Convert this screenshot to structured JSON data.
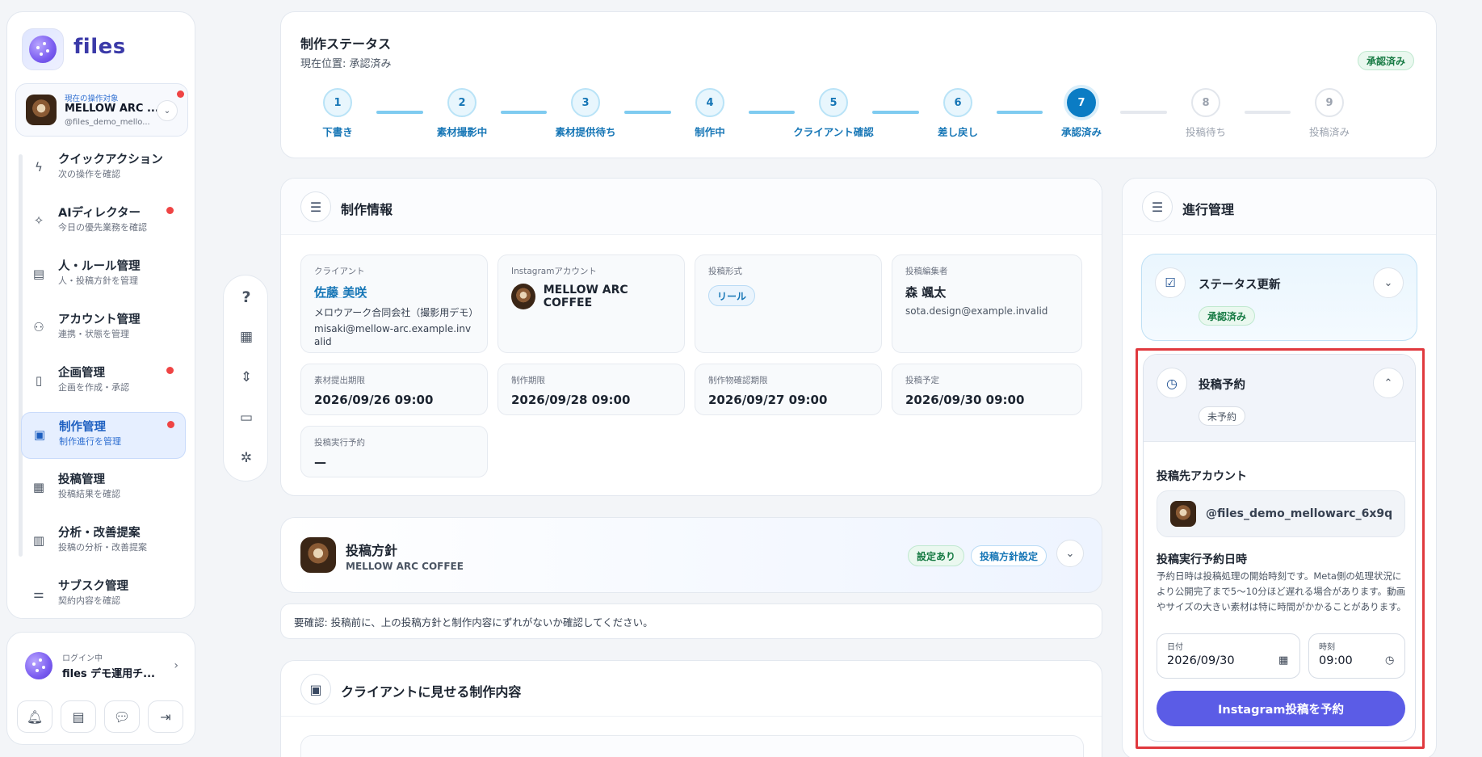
{
  "brand": {
    "name": "files"
  },
  "account_switcher": {
    "caption": "現在の操作対象",
    "name": "MELLOW ARC ...",
    "handle": "@files_demo_mello..."
  },
  "nav": {
    "items": [
      {
        "label": "クイックアクション",
        "sub": "次の操作を確認",
        "icon": "bolt-icon",
        "dot": false
      },
      {
        "label": "AIディレクター",
        "sub": "今日の優先業務を確認",
        "icon": "sparkle-icon",
        "dot": true
      },
      {
        "label": "人・ルール管理",
        "sub": "人・投稿方針を管理",
        "icon": "rules-icon",
        "dot": false
      },
      {
        "label": "アカウント管理",
        "sub": "連携・状態を管理",
        "icon": "users-icon",
        "dot": false
      },
      {
        "label": "企画管理",
        "sub": "企画を作成・承認",
        "icon": "document-icon",
        "dot": true
      },
      {
        "label": "制作管理",
        "sub": "制作進行を管理",
        "icon": "clipboard-icon",
        "dot": true,
        "active": true
      },
      {
        "label": "投稿管理",
        "sub": "投稿結果を確認",
        "icon": "calendar-icon",
        "dot": false
      },
      {
        "label": "分析・改善提案",
        "sub": "投稿の分析・改善提案",
        "icon": "chart-file-icon",
        "dot": false
      },
      {
        "label": "サブスク管理",
        "sub": "契約内容を確認",
        "icon": "sliders-icon",
        "dot": false
      }
    ]
  },
  "user": {
    "caption": "ログイン中",
    "name": "files デモ運用チ..."
  },
  "status": {
    "title": "制作ステータス",
    "current": "現在位置: 承認済み",
    "badge": "承認済み",
    "steps": [
      {
        "n": "1",
        "label": "下書き",
        "state": "done"
      },
      {
        "n": "2",
        "label": "素材撮影中",
        "state": "done"
      },
      {
        "n": "3",
        "label": "素材提供待ち",
        "state": "done"
      },
      {
        "n": "4",
        "label": "制作中",
        "state": "done"
      },
      {
        "n": "5",
        "label": "クライアント確認",
        "state": "done"
      },
      {
        "n": "6",
        "label": "差し戻し",
        "state": "done"
      },
      {
        "n": "7",
        "label": "承認済み",
        "state": "current"
      },
      {
        "n": "8",
        "label": "投稿待ち",
        "state": "future"
      },
      {
        "n": "9",
        "label": "投稿済み",
        "state": "future"
      }
    ]
  },
  "info": {
    "title": "制作情報",
    "client_label": "クライアント",
    "client_name": "佐藤 美咲",
    "client_company": "メロウアーク合同会社（撮影用デモ）",
    "client_email": "misaki@mellow-arc.example.invalid",
    "ig_label": "Instagramアカウント",
    "ig_value": "MELLOW ARC COFFEE",
    "format_label": "投稿形式",
    "format_value": "リール",
    "editor_label": "投稿編集者",
    "editor_name": "森 颯太",
    "editor_email": "sota.design@example.invalid",
    "material_deadline_label": "素材提出期限",
    "material_deadline": "2026/09/26 09:00",
    "production_deadline_label": "制作期限",
    "production_deadline": "2026/09/28 09:00",
    "review_deadline_label": "制作物確認期限",
    "review_deadline": "2026/09/27 09:00",
    "post_plan_label": "投稿予定",
    "post_plan": "2026/09/30 09:00",
    "exec_label": "投稿実行予約",
    "exec_value": "—"
  },
  "policy": {
    "title": "投稿方針",
    "sub": "MELLOW ARC COFFEE",
    "badge": "設定あり",
    "button": "投稿方針設定"
  },
  "note": "要確認: 投稿前に、上の投稿方針と制作内容にずれがないか確認してください。",
  "client_content": {
    "title": "クライアントに見せる制作内容"
  },
  "progress": {
    "title": "進行管理",
    "status_update": {
      "title": "ステータス更新",
      "badge": "承認済み"
    },
    "schedule": {
      "title": "投稿予約",
      "badge": "未予約",
      "target_label": "投稿先アカウント",
      "target_account": "@files_demo_mellowarc_6x9q",
      "datetime_label": "投稿実行予約日時",
      "help": "予約日時は投稿処理の開始時刻です。Meta側の処理状況により公開完了まで5〜10分ほど遅れる場合があります。動画やサイズの大きい素材は特に時間がかかることがあります。",
      "date_label": "日付",
      "date_value": "2026/09/30",
      "time_label": "時刻",
      "time_value": "09:00",
      "submit": "Instagram投稿を予約"
    }
  }
}
